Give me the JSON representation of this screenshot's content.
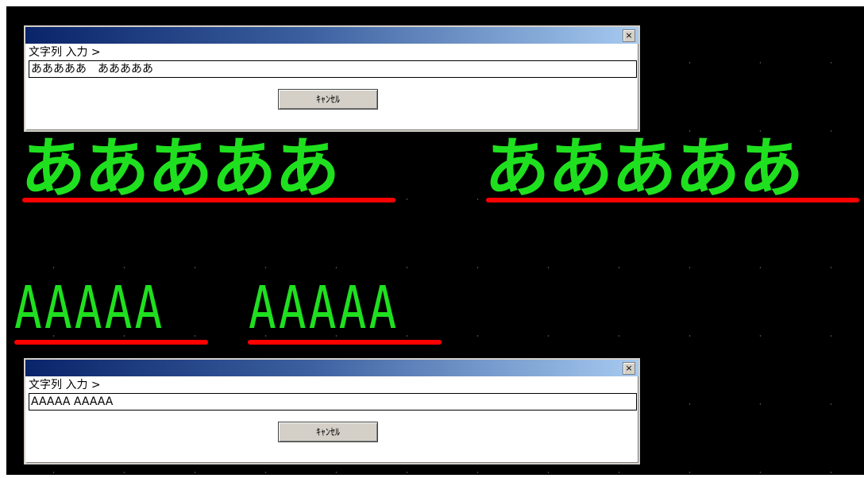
{
  "dialogs": {
    "top": {
      "prompt": "文字列 入力 >",
      "input_value": "あああああ　あああああ",
      "cancel_label": "ｷｬﾝｾﾙ",
      "close_glyph": "×"
    },
    "bottom": {
      "prompt": "文字列 入力 >",
      "input_value": "AAAAA AAAAA",
      "cancel_label": "ｷｬﾝｾﾙ",
      "close_glyph": "×"
    }
  },
  "canvas": {
    "japanese_word_1": "あああああ",
    "japanese_word_2": "あああああ",
    "latin_word_1": "AAAAA",
    "latin_word_2": "AAAAA"
  },
  "colors": {
    "background": "#000000",
    "text": "#1fe01f",
    "underline": "#ff0000"
  }
}
